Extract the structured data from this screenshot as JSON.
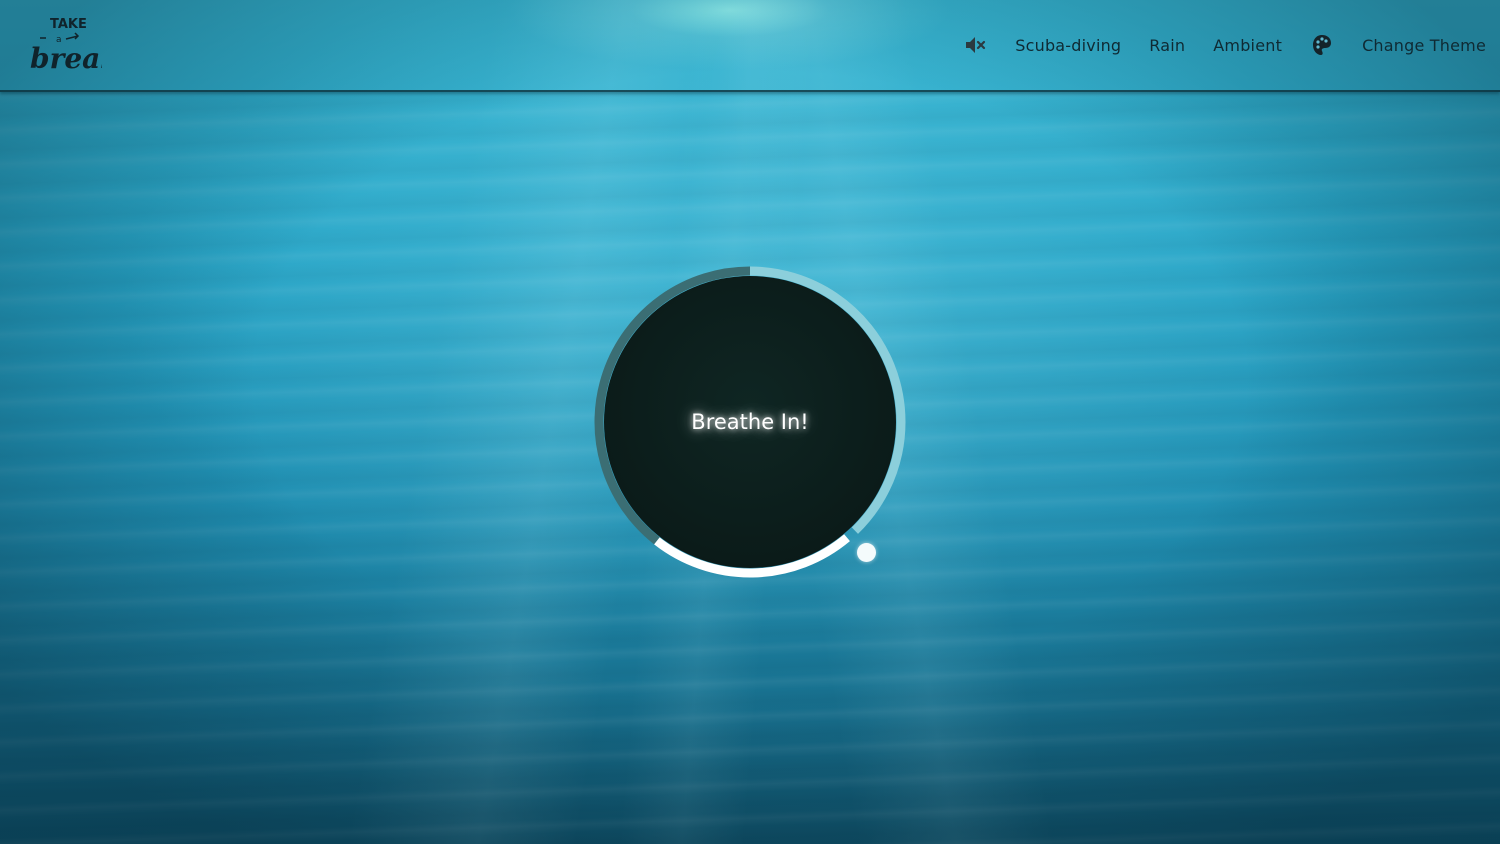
{
  "app": {
    "logo_text_top": "TAKE",
    "logo_text_mid": "a",
    "logo_text_main": "break"
  },
  "nav": {
    "mute_icon": "speaker-muted-icon",
    "items": [
      {
        "label": "Scuba-diving"
      },
      {
        "label": "Rain"
      },
      {
        "label": "Ambient"
      }
    ],
    "theme_icon": "palette-icon",
    "change_theme_label": "Change Theme"
  },
  "breath": {
    "instruction": "Breathe In!",
    "progress": 0.38
  },
  "colors": {
    "text_dark": "#0f2a33",
    "circle_core": "#0b1b19",
    "ring_track": "#3a6e73",
    "ring_track_light": "#8fd0dc",
    "ring_progress": "#ffffff"
  }
}
